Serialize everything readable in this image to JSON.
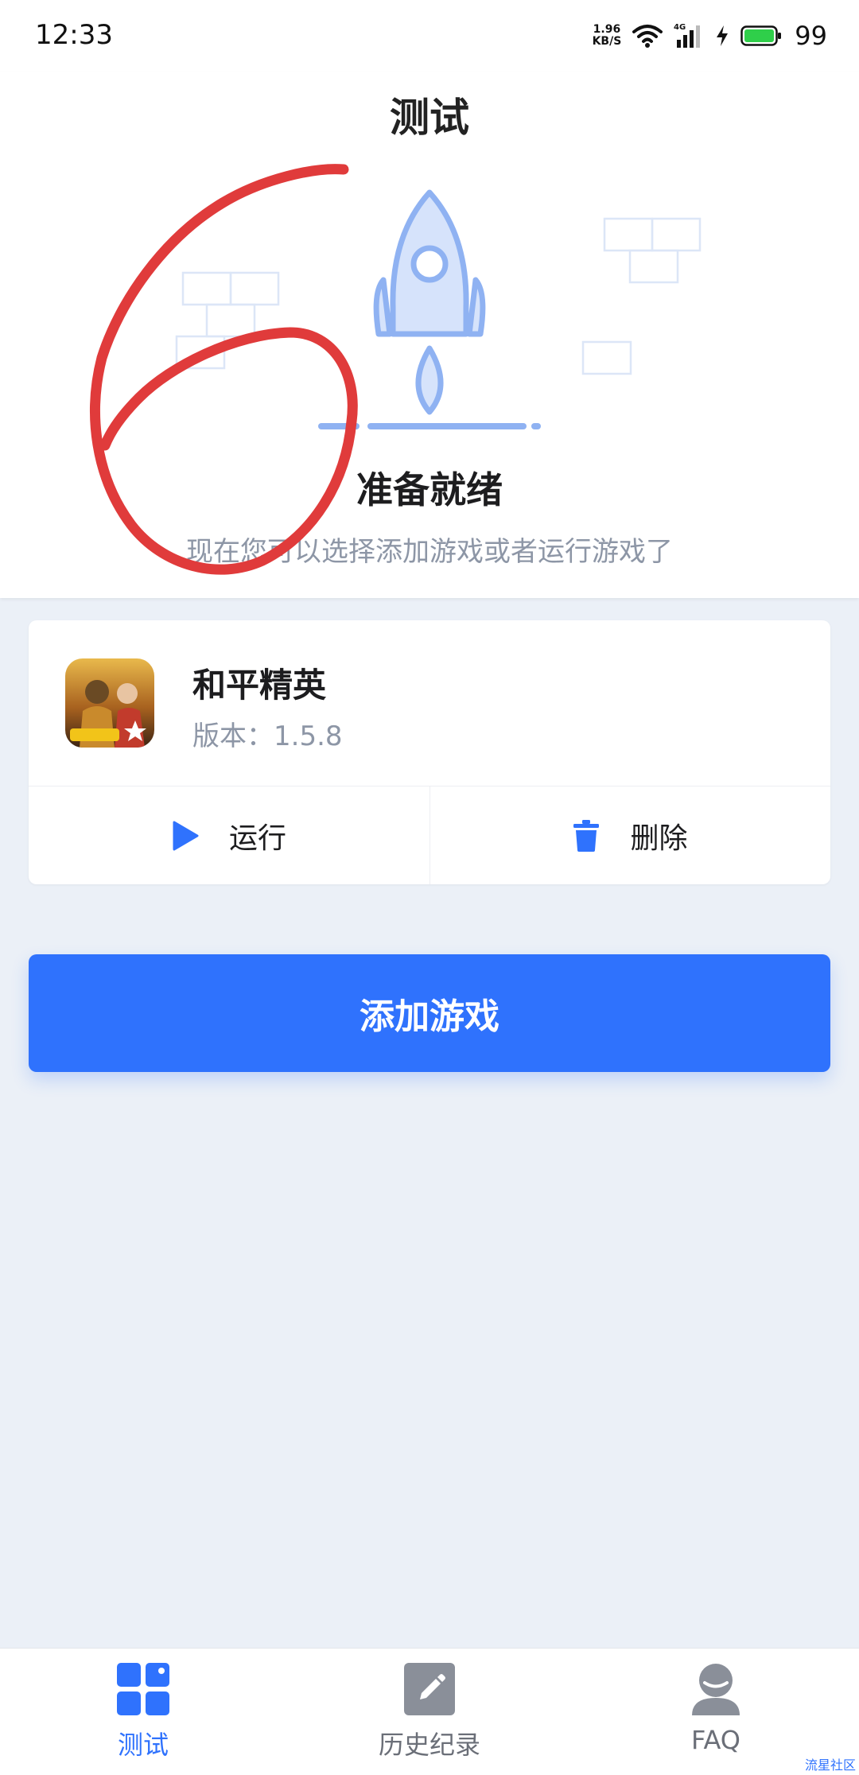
{
  "status_bar": {
    "time": "12:33",
    "net_speed_value": "1.96",
    "net_speed_unit": "KB/S",
    "network_type": "4G",
    "battery_percent": "99"
  },
  "header": {
    "title": "测试",
    "hero_title": "准备就绪",
    "hero_subtitle": "现在您可以选择添加游戏或者运行游戏了"
  },
  "game_card": {
    "name": "和平精英",
    "version": "版本：1.5.8",
    "run_label": "运行",
    "delete_label": "删除"
  },
  "add_game_label": "添加游戏",
  "bottom_nav": {
    "items": [
      {
        "label": "测试",
        "icon": "dashboard-icon",
        "active": true
      },
      {
        "label": "历史纪录",
        "icon": "edit-icon",
        "active": false
      },
      {
        "label": "FAQ",
        "icon": "user-support-icon",
        "active": false
      }
    ]
  },
  "watermark": "流星社区",
  "colors": {
    "accent": "#2f72fd",
    "background": "#ebf0f7",
    "annotation": "#e03b3b"
  }
}
